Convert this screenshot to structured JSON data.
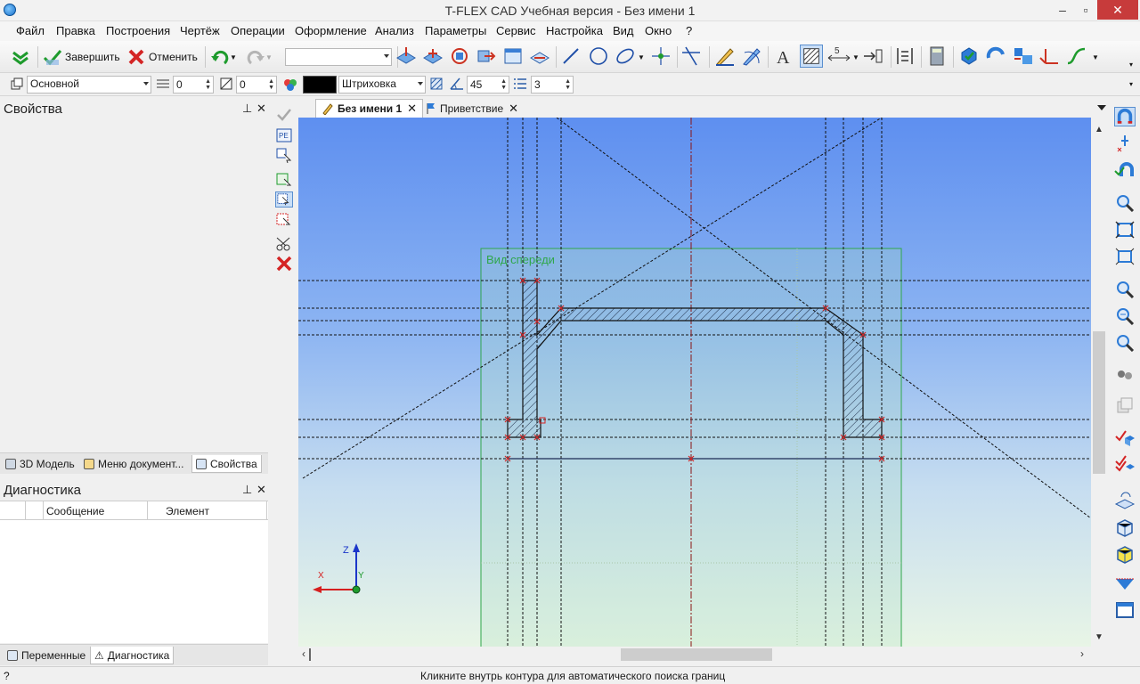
{
  "window": {
    "title": "T-FLEX CAD Учебная версия - Без имени 1",
    "minimize": "–",
    "maximize": "▫",
    "close": "✕"
  },
  "menu": [
    "Файл",
    "Правка",
    "Построения",
    "Чертёж",
    "Операции",
    "Оформление",
    "Анализ",
    "Параметры",
    "Сервис",
    "Настройка",
    "Вид",
    "Окно",
    "?"
  ],
  "toolbar1": {
    "finish_label": "Завершить",
    "cancel_label": "Отменить",
    "combo_value": ""
  },
  "toolbar2": {
    "layer": "Основной",
    "level": "0",
    "priority": "0",
    "hatch_type": "Штриховка",
    "angle": "45",
    "step": "3",
    "color": "#000000"
  },
  "properties_panel": {
    "title": "Свойства",
    "pin": "⊥",
    "close": "✕"
  },
  "left_tabs": [
    "3D Модель",
    "Меню документ...",
    "Свойства"
  ],
  "diagnostics_panel": {
    "title": "Диагностика",
    "pin": "⊥",
    "close": "✕",
    "columns": [
      "Сообщение",
      "Элемент"
    ]
  },
  "bottom_tabs": [
    "Переменные",
    "Диагностика"
  ],
  "doc_tabs": [
    {
      "label": "Без имени 1",
      "close": "✕"
    },
    {
      "label": "Приветствие",
      "close": "✕"
    }
  ],
  "canvas": {
    "view_label": "Вид спереди",
    "axis_z": "Z",
    "axis_x": "X",
    "axis_y": "Y"
  },
  "status": {
    "help": "?",
    "message": "Кликните внутрь контура для автоматического поиска границ"
  },
  "colors": {
    "accent_close": "#c73b3b",
    "view_frame": "#2fa64a",
    "axis_z": "#1b36c9",
    "axis_x": "#d62020",
    "construction": "#111111"
  }
}
